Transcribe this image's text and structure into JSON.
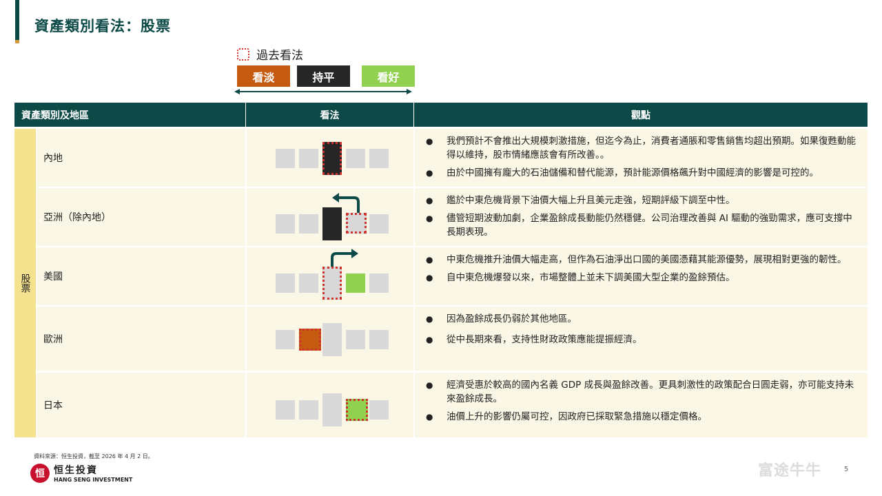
{
  "page": {
    "title": "資產類別看法：股票",
    "page_number": "5"
  },
  "legend": {
    "past_view_label": "過去看法",
    "bear_label": "看淡",
    "neutral_label": "持平",
    "bull_label": "看好",
    "colors": {
      "bear": "#c55a11",
      "neutral": "#262626",
      "bull": "#92d050",
      "past_border": "#d0312d"
    }
  },
  "table": {
    "headers": {
      "region": "資產類別及地區",
      "view": "看法",
      "comments": "觀點"
    },
    "category": "股票",
    "rows": [
      {
        "region": "內地",
        "view": {
          "current": 3,
          "past": 3,
          "current_label": "持平",
          "past_label": "持平"
        },
        "comments": [
          "我們預計不會推出大規模刺激措施，但迄今為止，消費者通脹和零售銷售均超出預期。如果復甦動能得以維持，股市情緒應該會有所改善。。",
          "由於中國擁有龐大的石油儲備和替代能源，預計能源價格飆升對中國經濟的影響是可控的。"
        ]
      },
      {
        "region": "亞洲（除內地）",
        "view": {
          "current": 3,
          "past": 4,
          "current_label": "持平",
          "past_label": "輕微看好",
          "change": "downgrade"
        },
        "comments": [
          "鑑於中東危機背景下油價大幅上升且美元走強，短期評級下調至中性。",
          "儘管短期波動加劇，企業盈餘成長動能仍然穩健。公司治理改善與 AI 驅動的強勁需求，應可支撐中長期表現。"
        ]
      },
      {
        "region": "美國",
        "view": {
          "current": 4,
          "past": 3,
          "current_label": "輕微看好",
          "past_label": "持平",
          "change": "upgrade"
        },
        "comments": [
          "中東危機推升油價大幅走高，但作為石油淨出口國的美國憑藉其能源優勢，展現相對更強的韌性。",
          "自中東危機爆發以來，市場整體上並未下調美國大型企業的盈餘預估。"
        ]
      },
      {
        "region": "歐洲",
        "view": {
          "current": 2,
          "past": 2,
          "current_label": "輕微看淡",
          "past_label": "輕微看淡"
        },
        "comments": [
          "因為盈餘成長仍弱於其他地區。",
          "從中長期來看，支持性財政政策應能提振經濟。"
        ]
      },
      {
        "region": "日本",
        "view": {
          "current": 4,
          "past": 4,
          "current_label": "輕微看好",
          "past_label": "輕微看好"
        },
        "comments": [
          "經濟受惠於較高的國內名義 GDP 成長與盈餘改善。更具刺激性的政策配合日圓走弱，亦可能支持未來盈餘成長。",
          "油價上升的影響仍屬可控，因政府已採取緊急措施以穩定價格。"
        ]
      }
    ]
  },
  "footer": {
    "source_note": "資料來源：恒生投資，截至 2026 年 4 月 2 日。",
    "logo_zh": "恒生投資",
    "logo_en": "HANG SENG INVESTMENT",
    "watermark": "富途牛牛"
  }
}
